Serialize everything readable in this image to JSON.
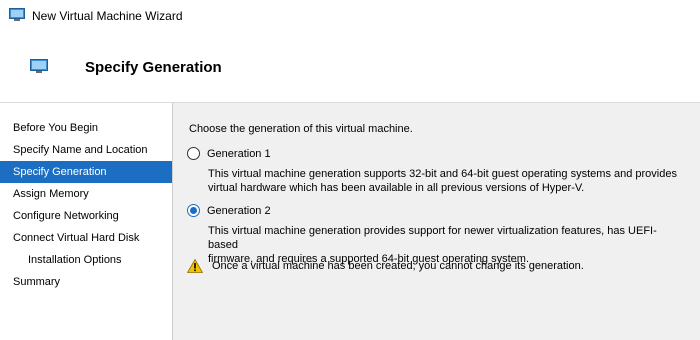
{
  "window": {
    "title": "New Virtual Machine Wizard",
    "icon": "vm-wizard-icon"
  },
  "header": {
    "title": "Specify Generation",
    "icon": "vm-monitor-icon"
  },
  "sidebar": {
    "items": [
      {
        "label": "Before You Begin"
      },
      {
        "label": "Specify Name and Location"
      },
      {
        "label": "Specify Generation"
      },
      {
        "label": "Assign Memory"
      },
      {
        "label": "Configure Networking"
      },
      {
        "label": "Connect Virtual Hard Disk"
      },
      {
        "label": "Installation Options"
      },
      {
        "label": "Summary"
      }
    ],
    "active_index": 2
  },
  "content": {
    "intro": "Choose the generation of this virtual machine.",
    "gen1": {
      "label": "Generation 1",
      "checked": false,
      "desc_line1": "This virtual machine generation supports 32-bit and 64-bit guest operating systems and provides",
      "desc_line2": "virtual hardware which has been available in all previous versions of Hyper-V."
    },
    "gen2": {
      "label": "Generation 2",
      "checked": true,
      "desc_line1": "This virtual machine generation provides support for newer virtualization features, has UEFI-based",
      "desc_line2": "firmware, and requires a supported 64-bit guest operating system."
    },
    "warning": {
      "icon": "warning-icon",
      "text": "Once a virtual machine has been created, you cannot change its generation."
    }
  },
  "colors": {
    "accent": "#1b6ec2",
    "warning": "#f2c200"
  }
}
